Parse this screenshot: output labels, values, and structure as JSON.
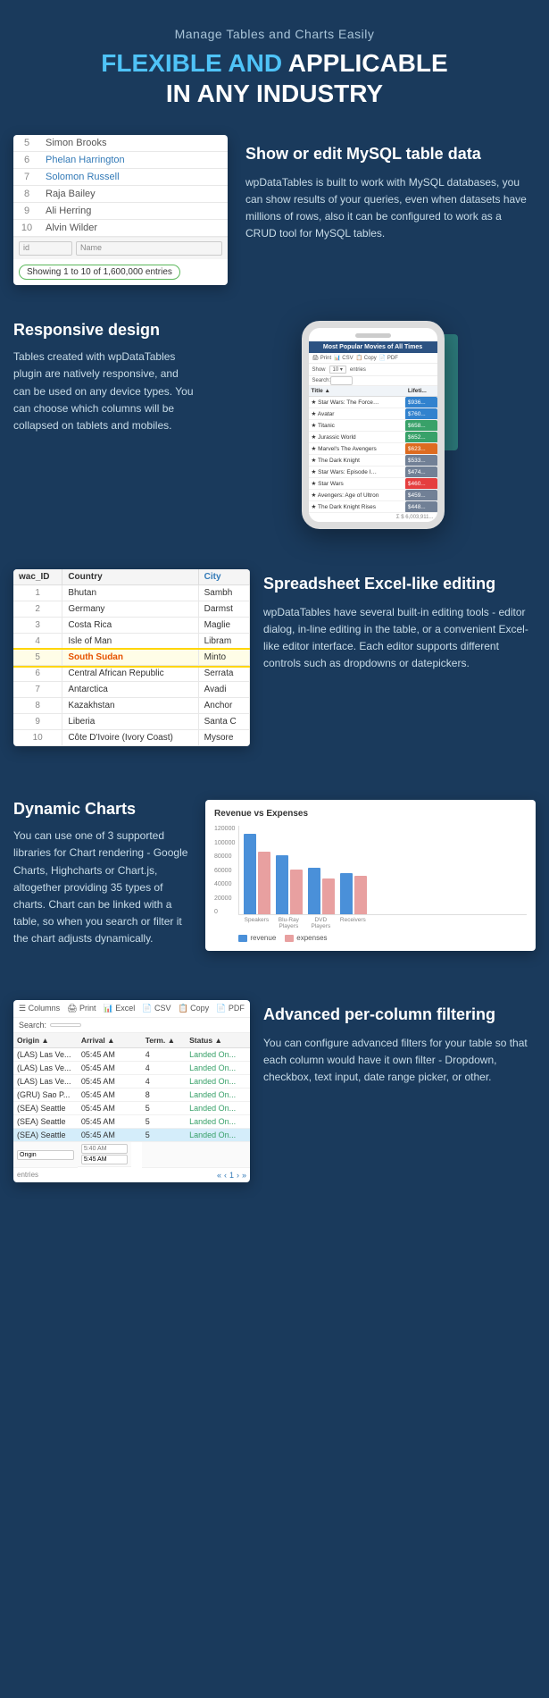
{
  "header": {
    "subtitle": "Manage Tables and Charts Easily",
    "title_line1": "FLEXIBLE AND APPLICABLE",
    "title_line2": "IN ANY INDUSTRY",
    "title_highlight": "FLEXIBLE AND APPLICABLE"
  },
  "mysql_section": {
    "heading": "Show or edit MySQL table data",
    "body": "wpDataTables is built to work with MySQL databases, you can show results of your queries, even when datasets have millions of rows, also it can be configured to work as a CRUD tool for MySQL tables.",
    "table": {
      "rows": [
        {
          "id": "5",
          "name": "Simon Brooks"
        },
        {
          "id": "6",
          "name": "Phelan Harrington"
        },
        {
          "id": "7",
          "name": "Solomon Russell"
        },
        {
          "id": "8",
          "name": "Raja Bailey"
        },
        {
          "id": "9",
          "name": "Ali Herring"
        },
        {
          "id": "10",
          "name": "Alvin Wilder"
        }
      ],
      "footer_text": "Showing 1 to 10 of 1,600,000 entries",
      "col_id": "id",
      "col_name": "Name"
    }
  },
  "responsive_section": {
    "heading": "Responsive design",
    "body": "Tables created with wpDataTables plugin are natively responsive, and can be used on any device types. You can choose which columns will be collapsed on tablets and mobiles.",
    "phone_table": {
      "title": "Most Popular Movies of All Times",
      "controls": [
        "Print",
        "CSV",
        "Copy",
        "PDF"
      ],
      "show_label": "Show",
      "entries_label": "entries",
      "search_label": "Search:",
      "col_title": "Title",
      "col_lifei": "Lifeti...",
      "rows": [
        {
          "title": "★ Star Wars: The Force Awakens",
          "val": "$936...",
          "color": "blue"
        },
        {
          "title": "★ Avatar",
          "val": "$760...",
          "color": "blue"
        },
        {
          "title": "★ Titanic",
          "val": "$658...",
          "color": "green"
        },
        {
          "title": "★ Jurassic World",
          "val": "$652...",
          "color": "green"
        },
        {
          "title": "★ Marvel's The Avengers",
          "val": "$623...",
          "color": "orange"
        },
        {
          "title": "★ The Dark Knight",
          "val": "$533...",
          "color": "gray"
        },
        {
          "title": "★ Star Wars: Episode I - The Phantom Menace",
          "val": "$474...",
          "color": "gray"
        },
        {
          "title": "★ Star Wars",
          "val": "$460...",
          "color": "red"
        },
        {
          "title": "★ Avengers: Age of Ultron",
          "val": "$459...",
          "color": "gray"
        },
        {
          "title": "★ The Dark Knight Rises",
          "val": "$448...",
          "color": "gray"
        }
      ],
      "total": "$ 6,003,911..."
    }
  },
  "spreadsheet_section": {
    "heading": "Spreadsheet Excel-like editing",
    "body": "wpDataTables have several built-in editing tools - editor dialog, in-line editing in the table, or a convenient Excel-like editor interface. Each editor supports different controls such as dropdowns or datepickers.",
    "table": {
      "col_wac_id": "wac_ID",
      "col_country": "Country",
      "col_city": "City",
      "rows": [
        {
          "id": "1",
          "country": "Bhutan",
          "city": "Sambh"
        },
        {
          "id": "2",
          "country": "Germany",
          "city": "Darmst"
        },
        {
          "id": "3",
          "country": "Costa Rica",
          "city": "Maglie"
        },
        {
          "id": "4",
          "country": "Isle of Man",
          "city": "Libram"
        },
        {
          "id": "5",
          "country": "South Sudan",
          "city": "Minto",
          "highlight": true
        },
        {
          "id": "6",
          "country": "Central African Republic",
          "city": "Serrata"
        },
        {
          "id": "7",
          "country": "Antarctica",
          "city": "Avadi"
        },
        {
          "id": "8",
          "country": "Kazakhstan",
          "city": "Anchor"
        },
        {
          "id": "9",
          "country": "Liberia",
          "city": "Santa C"
        },
        {
          "id": "10",
          "country": "Côte D'Ivoire (Ivory Coast)",
          "city": "Mysore"
        }
      ]
    }
  },
  "charts_section": {
    "heading": "Dynamic Charts",
    "body": "You can use one of 3 supported libraries for Chart rendering - Google Charts, Highcharts or Chart.js, altogether providing 35 types of charts. Chart can be linked with a table, so when you search or filter it the chart adjusts dynamically.",
    "chart": {
      "title": "Revenue vs Expenses",
      "y_labels": [
        "120000",
        "100000",
        "80000",
        "60000",
        "40000",
        "20000",
        "0"
      ],
      "categories": [
        "Speakers",
        "Blu-Ray Players",
        "DVD Players",
        "Receivers"
      ],
      "revenue": [
        108,
        80,
        63,
        55
      ],
      "expenses": [
        85,
        60,
        48,
        52
      ],
      "legend_revenue": "revenue",
      "legend_expenses": "expenses"
    }
  },
  "filtering_section": {
    "heading": "Advanced per-column filtering",
    "body": "You can configure advanced filters for your table so that each column would have it own filter - Dropdown, checkbox, text input, date range picker, or other.",
    "table": {
      "toolbar": [
        "Columns",
        "Print",
        "Excel",
        "CSV",
        "Copy",
        "PDF"
      ],
      "search_label": "Search:",
      "col_origin": "Origin",
      "col_arrival": "Arrival",
      "col_term": "Term.",
      "col_status": "Status",
      "rows": [
        {
          "origin": "(LAS) Las Ve...",
          "arrival": "05:45 AM",
          "term": "4",
          "status": "Landed On..."
        },
        {
          "origin": "(LAS) Las Ve...",
          "arrival": "05:45 AM",
          "term": "4",
          "status": "Landed On..."
        },
        {
          "origin": "(LAS) Las Ve...",
          "arrival": "05:45 AM",
          "term": "4",
          "status": "Landed On..."
        },
        {
          "origin": "(GRU) Sao P...",
          "arrival": "05:45 AM",
          "term": "8",
          "status": "Landed On..."
        },
        {
          "origin": "(SEA) Seattle",
          "arrival": "05:45 AM",
          "term": "5",
          "status": "Landed On..."
        },
        {
          "origin": "(SEA) Seattle",
          "arrival": "05:45 AM",
          "term": "5",
          "status": "Landed On..."
        },
        {
          "origin": "(SEA) Seattle",
          "arrival": "05:45 AM",
          "term": "5",
          "status": "Landed On...",
          "selected": true
        }
      ],
      "filter_origin": "Origin",
      "filter_arrival_placeholder": "5:40 AM",
      "filter_arrival_value": "5:45 AM",
      "footer_entries": "entries",
      "pagination": [
        "«",
        "‹",
        "1",
        "›",
        "»"
      ]
    }
  }
}
